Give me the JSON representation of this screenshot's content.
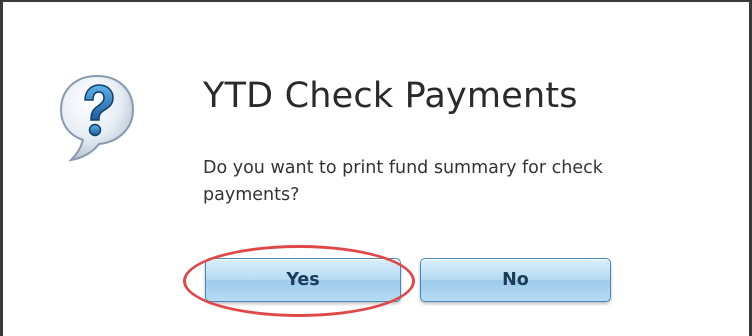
{
  "dialog": {
    "title": "YTD Check Payments",
    "message": "Do you want to print fund summary for check payments?",
    "icon": "question-icon",
    "buttons": {
      "yes_label": "Yes",
      "no_label": "No"
    },
    "highlighted_button": "Yes"
  },
  "colors": {
    "icon_blue": "#2f86c8",
    "button_blue": "#b7dcf4",
    "highlight_red": "#e04848"
  }
}
